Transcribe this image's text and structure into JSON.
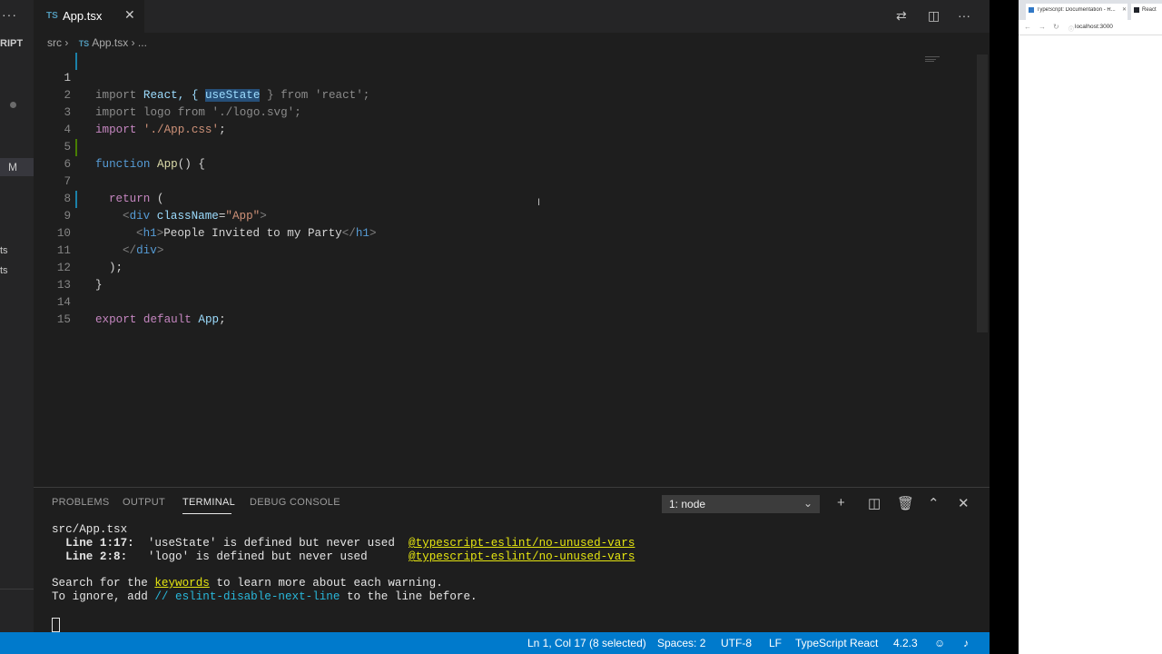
{
  "sidebar": {
    "more_icon": "ellipsis-icon",
    "title_fragment": "RIPT",
    "modified_badge": "M",
    "item_fragment_1": "ts",
    "item_fragment_2": "ts"
  },
  "tabs": [
    {
      "lang": "TS",
      "name": "App.tsx",
      "close": "✕"
    }
  ],
  "breadcrumb": {
    "folder": "src",
    "sep1": "›",
    "lang": "TS",
    "file": "App.tsx",
    "sep2": "›",
    "more": "..."
  },
  "editor": {
    "lines": [
      {
        "n": "1"
      },
      {
        "n": "2"
      },
      {
        "n": "3"
      },
      {
        "n": "4"
      },
      {
        "n": "5"
      },
      {
        "n": "6"
      },
      {
        "n": "7"
      },
      {
        "n": "8"
      },
      {
        "n": "9"
      },
      {
        "n": "10"
      },
      {
        "n": "11"
      },
      {
        "n": "12"
      },
      {
        "n": "13"
      },
      {
        "n": "14"
      },
      {
        "n": "15"
      }
    ],
    "code": {
      "l1_a": "import",
      "l1_b": " React, { ",
      "l1_sel": "useState",
      "l1_c": " } ",
      "l1_d": "from",
      "l1_e": " 'react'",
      "l1_f": ";",
      "l2_a": "import",
      "l2_b": " logo ",
      "l2_c": "from",
      "l2_d": " './logo.svg'",
      "l2_e": ";",
      "l3_a": "import",
      "l3_b": " './App.css'",
      "l3_c": ";",
      "l5_a": "function",
      "l5_b": " App",
      "l5_c": "() {",
      "l7_a": "return",
      "l7_b": " (",
      "l8_a": "<",
      "l8_b": "div",
      "l8_c": " className",
      "l8_d": "=",
      "l8_e": "\"App\"",
      "l8_f": ">",
      "l9_a": "<",
      "l9_b": "h1",
      "l9_c": ">",
      "l9_d": "People Invited to my Party",
      "l9_e": "</",
      "l9_f": "h1",
      "l9_g": ">",
      "l10_a": "</",
      "l10_b": "div",
      "l10_c": ">",
      "l11": ");",
      "l12": "}",
      "l14_a": "export",
      "l14_b": " default",
      "l14_c": " App",
      "l14_d": ";"
    }
  },
  "panel": {
    "tabs": [
      "PROBLEMS",
      "OUTPUT",
      "TERMINAL",
      "DEBUG CONSOLE"
    ],
    "active_tab": "TERMINAL",
    "terminal_select": "1: node",
    "terminal": {
      "file": "src/App.tsx",
      "w1_loc": "Line 1:17:",
      "w1_msg": "  'useState' is defined but never used  ",
      "w1_rule": "@typescript-eslint/no-unused-vars",
      "w2_loc": "Line 2:8:",
      "w2_msg": "   'logo' is defined but never used      ",
      "w2_rule": "@typescript-eslint/no-unused-vars",
      "search_a": "Search for the ",
      "search_link": "keywords",
      "search_b": " to learn more about each warning.",
      "ignore_a": "To ignore, add ",
      "ignore_code": "// eslint-disable-next-line",
      "ignore_b": " to the line before."
    }
  },
  "status": {
    "position": "Ln 1, Col 17 (8 selected)",
    "spaces": "Spaces: 2",
    "encoding": "UTF-8",
    "eol": "LF",
    "language": "TypeScript React",
    "version": "4.2.3"
  },
  "browser": {
    "tab1": "TypeScript: Documentation - R...",
    "tab2": "React",
    "url": "localhost:3000"
  },
  "colors": {
    "status_bar": "#007acc",
    "editor_bg": "#1e1e1e",
    "selection": "#264f78"
  }
}
